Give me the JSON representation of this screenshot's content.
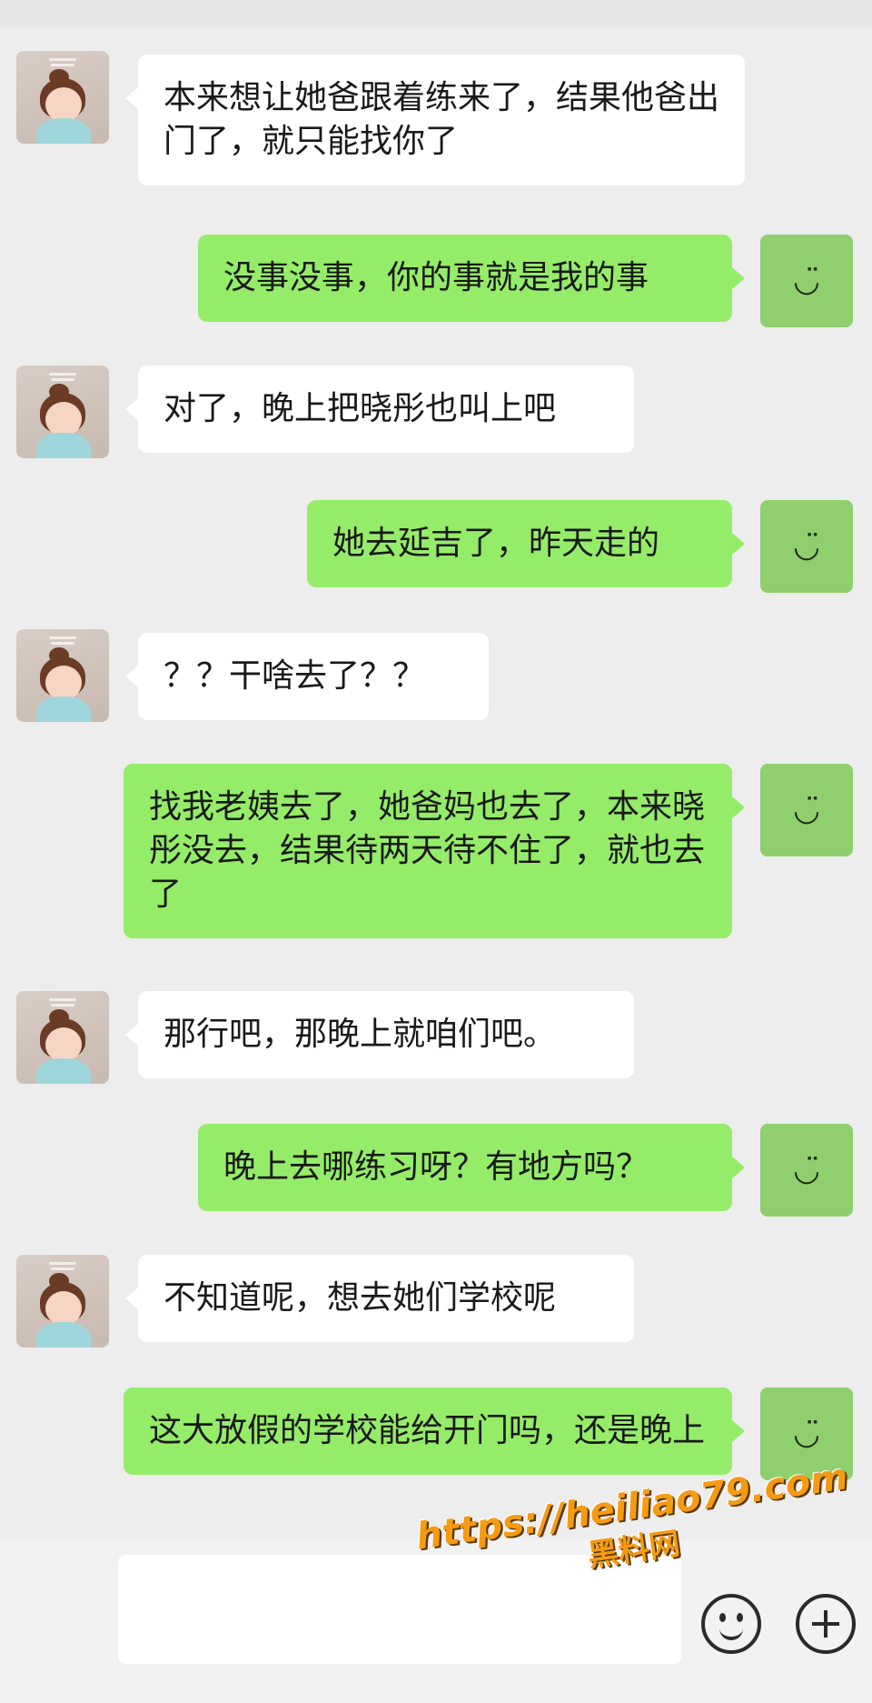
{
  "messages": [
    {
      "side": "in",
      "text": "本来想让她爸跟着练来了，结果他爸出门了，就只能找你了"
    },
    {
      "side": "out",
      "text": "没事没事，你的事就是我的事"
    },
    {
      "side": "in",
      "text": "对了，晚上把晓彤也叫上吧"
    },
    {
      "side": "out",
      "text": "她去延吉了，昨天走的"
    },
    {
      "side": "in",
      "text": "？？干啥去了？？"
    },
    {
      "side": "out",
      "text": "找我老姨去了，她爸妈也去了，本来晓彤没去，结果待两天待不住了，就也去了"
    },
    {
      "side": "in",
      "text": "那行吧，那晚上就咱们吧。"
    },
    {
      "side": "out",
      "text": "晚上去哪练习呀？有地方吗？"
    },
    {
      "side": "in",
      "text": "不知道呢，想去她们学校呢"
    },
    {
      "side": "out",
      "text": "这大放假的学校能给开门吗，还是晚上"
    }
  ],
  "self_avatar_icon": "smile-icon",
  "watermark": {
    "url": "https://heiliao79.com",
    "name": "黑料网"
  },
  "colors": {
    "background": "#ededed",
    "incoming_bubble": "#ffffff",
    "outgoing_bubble": "#95ec69",
    "self_avatar": "#8fcf6e",
    "watermark": "#f59b12"
  }
}
